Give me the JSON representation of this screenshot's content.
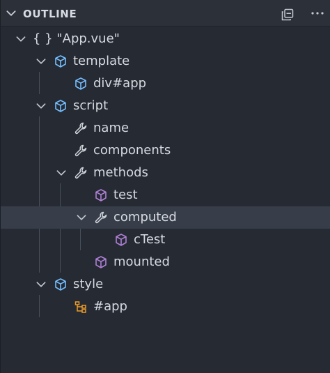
{
  "header": {
    "title": "OUTLINE",
    "collapse_icon": "collapse-all-icon",
    "more_icon": "more-actions-icon"
  },
  "colors": {
    "module_blue": "#75beff",
    "method_purple": "#b180d7",
    "selector_orange": "#ee9d28",
    "text": "#d6dae0",
    "selection": "#383e49"
  },
  "tree": {
    "root": {
      "label": "{ } \"App.vue\"",
      "icon": "braces-icon"
    },
    "template": {
      "label": "template",
      "icon": "module-icon"
    },
    "div_app": {
      "label": "div#app",
      "icon": "module-icon"
    },
    "script": {
      "label": "script",
      "icon": "module-icon"
    },
    "name": {
      "label": "name",
      "icon": "wrench-icon"
    },
    "components": {
      "label": "components",
      "icon": "wrench-icon"
    },
    "methods": {
      "label": "methods",
      "icon": "wrench-icon"
    },
    "test": {
      "label": "test",
      "icon": "method-cube-icon"
    },
    "computed": {
      "label": "computed",
      "icon": "wrench-icon"
    },
    "ctest": {
      "label": "cTest",
      "icon": "method-cube-icon"
    },
    "mounted": {
      "label": "mounted",
      "icon": "method-cube-icon"
    },
    "style": {
      "label": "style",
      "icon": "module-icon"
    },
    "style_app": {
      "label": "#app",
      "icon": "selector-icon"
    }
  }
}
